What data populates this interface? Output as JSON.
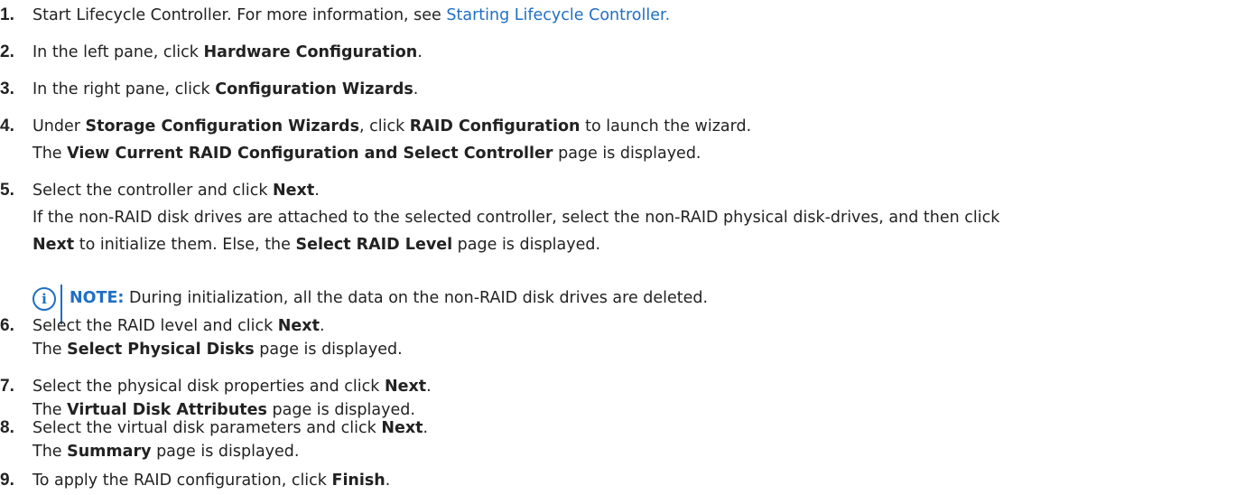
{
  "steps": [
    {
      "number": "1.",
      "text": "Start Lifecycle Controller. For more information, see ",
      "link": "Starting Lifecycle Controller."
    },
    {
      "number": "2.",
      "pre": "In the left pane, click ",
      "bold": "Hardware Configuration",
      "post": "."
    },
    {
      "number": "3.",
      "pre": "In the right pane, click ",
      "bold": "Configuration Wizards",
      "post": "."
    },
    {
      "number": "4.",
      "a_pre": "Under ",
      "a_bold1": "Storage Configuration Wizards",
      "a_mid": ", click ",
      "a_bold2": "RAID Configuration",
      "a_post": " to launch the wizard.",
      "b_pre": "The ",
      "b_bold": "View Current RAID Configuration and Select Controller",
      "b_post": " page is displayed."
    },
    {
      "number": "5.",
      "a_pre": "Select the controller and click ",
      "a_bold": "Next",
      "a_post": ".",
      "b_text": "If the non-RAID disk drives are attached to the selected controller, select the non-RAID physical disk-drives, and then click",
      "c_bold1": "Next",
      "c_mid": " to initialize them. Else, the ",
      "c_bold2": "Select RAID Level",
      "c_post": " page is displayed.",
      "note_icon": "i",
      "note_label": "NOTE:",
      "note_text": " During initialization, all the data on the non-RAID disk drives are deleted."
    },
    {
      "number": "6.",
      "a_pre": "Select the RAID level and click ",
      "a_bold": "Next",
      "a_post": ".",
      "b_pre": "The ",
      "b_bold": "Select Physical Disks",
      "b_post": " page is displayed."
    },
    {
      "number": "7.",
      "a_pre": "Select the physical disk properties and click ",
      "a_bold": "Next",
      "a_post": ".",
      "b_pre": "The ",
      "b_bold": "Virtual Disk Attributes",
      "b_post": " page is displayed."
    },
    {
      "number": "8.",
      "a_pre": "Select the virtual disk parameters and click ",
      "a_bold": "Next",
      "a_post": ".",
      "b_pre": "The ",
      "b_bold": "Summary",
      "b_post": " page is displayed."
    },
    {
      "number": "9.",
      "pre": "To apply the RAID configuration, click ",
      "bold": "Finish",
      "post": "."
    }
  ],
  "colors": {
    "text": "#222222",
    "accent": "#1f6fc4"
  },
  "icons": {
    "note": "info-circle-icon"
  }
}
